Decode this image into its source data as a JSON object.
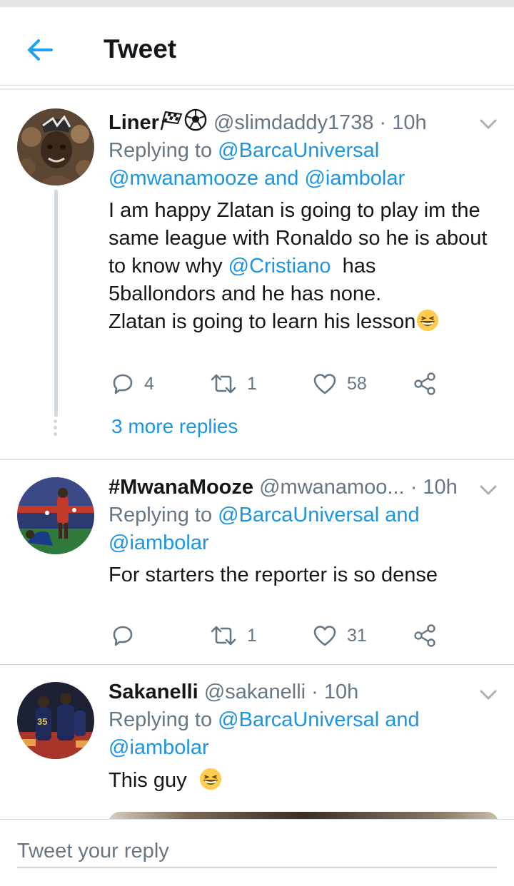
{
  "header": {
    "title": "Tweet",
    "back_icon": "arrow-left-icon",
    "accent": "#1da1f2"
  },
  "tweets": [
    {
      "name": "Liner",
      "handle": "@slimdaddy1738",
      "sep": "·",
      "time": "10h",
      "reply_prefix": "Replying to",
      "reply_user1": "@BarcaUniversal",
      "reply_user2": "@mwanamooze",
      "reply_and": "and",
      "reply_user3": "@iambolar",
      "text_1": "I am happy Zlatan is going to play im the",
      "text_2": "same league with Ronaldo so he is about",
      "text_3a": "to know why",
      "text_3_mention": "@Cristiano",
      "text_3b": "has",
      "text_4": "5ballondors and he has none.",
      "text_5": "Zlatan is going to learn his lesson",
      "replies": "4",
      "retweets": "1",
      "likes": "58",
      "more_replies": "3 more replies"
    },
    {
      "name": "#MwanaMooze",
      "handle": "@mwanamoo...",
      "sep": "·",
      "time": "10h",
      "reply_prefix": "Replying to",
      "reply_user1": "@BarcaUniversal",
      "reply_and": "and",
      "reply_user2": "@iambolar",
      "text_1": "For starters the reporter is so dense",
      "retweets": "1",
      "likes": "31"
    },
    {
      "name": "Sakanelli",
      "handle": "@sakanelli",
      "sep": "·",
      "time": "10h",
      "reply_prefix": "Replying to",
      "reply_user1": "@BarcaUniversal",
      "reply_and": "and",
      "reply_user2": "@iambolar",
      "text_1": "This guy",
      "avatar_jersey_number": "35"
    }
  ],
  "compose": {
    "placeholder": "Tweet your reply"
  }
}
